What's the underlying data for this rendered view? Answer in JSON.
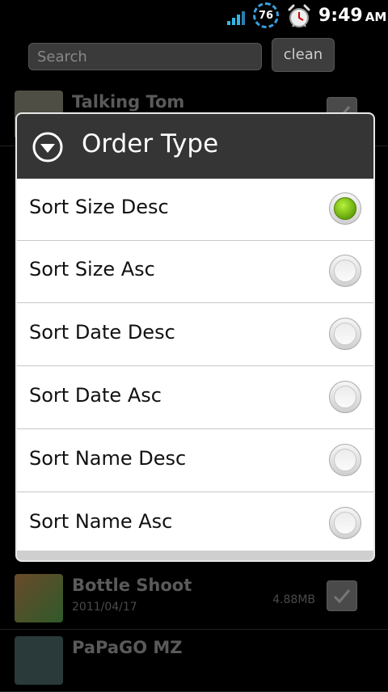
{
  "status_bar": {
    "battery_level": "76",
    "time": "9:49",
    "ampm": "AM",
    "signal_icon": "signal-bars-icon",
    "alarm_icon": "alarm-clock-icon"
  },
  "app": {
    "search": {
      "placeholder": "Search",
      "value": ""
    },
    "clean_label": "clean",
    "rows": [
      {
        "title": "Talking Tom",
        "date": "",
        "size": ""
      },
      {
        "title": "Bottle Shoot",
        "date": "2011/04/17",
        "size": "4.88MB"
      },
      {
        "title": "PaPaGO MZ",
        "date": "",
        "size": ""
      }
    ]
  },
  "dialog": {
    "title": "Order Type",
    "options": [
      {
        "label": "Sort Size Desc",
        "selected": true
      },
      {
        "label": "Sort Size Asc",
        "selected": false
      },
      {
        "label": "Sort Date Desc",
        "selected": false
      },
      {
        "label": "Sort Date Asc",
        "selected": false
      },
      {
        "label": "Sort Name Desc",
        "selected": false
      },
      {
        "label": "Sort Name Asc",
        "selected": false
      }
    ]
  },
  "colors": {
    "accent_blue": "#33b5e5",
    "radio_selected": "#7ac70e",
    "dialog_header": "#353535"
  }
}
